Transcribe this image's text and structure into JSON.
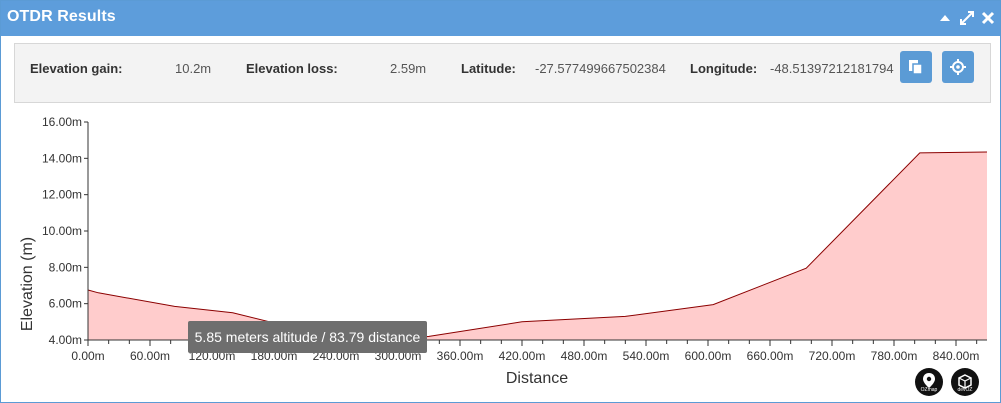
{
  "window": {
    "title": "OTDR Results"
  },
  "info": {
    "elevation_gain_label": "Elevation gain:",
    "elevation_gain_value": "10.2m",
    "elevation_loss_label": "Elevation loss:",
    "elevation_loss_value": "2.59m",
    "latitude_label": "Latitude:",
    "latitude_value": "-27.577499667502384",
    "longitude_label": "Longitude:",
    "longitude_value": "-48.51397212181794"
  },
  "tooltip": {
    "text": "5.85 meters altitude / 83.79 distance"
  },
  "logos": {
    "left": "OZmap",
    "right": "devOZ"
  },
  "colors": {
    "titlebar": "#5d9ddb",
    "fill": "#ffcccc",
    "line": "#8b0000",
    "button": "#5b9bd5"
  },
  "chart_data": {
    "type": "area",
    "xlabel": "Distance",
    "ylabel": "Elevation (m)",
    "xlim": [
      0,
      870
    ],
    "ylim": [
      4,
      16
    ],
    "x_ticks": [
      "0.00m",
      "60.00m",
      "120.00m",
      "180.00m",
      "240.00m",
      "300.00m",
      "360.00m",
      "420.00m",
      "480.00m",
      "540.00m",
      "600.00m",
      "660.00m",
      "720.00m",
      "780.00m",
      "840.00m"
    ],
    "y_ticks": [
      "4.00m",
      "6.00m",
      "8.00m",
      "10.00m",
      "12.00m",
      "14.00m",
      "16.00m"
    ],
    "x": [
      0,
      10,
      83.79,
      140,
      190,
      240,
      300,
      330,
      420,
      520,
      605,
      695,
      805,
      870
    ],
    "y": [
      6.75,
      6.6,
      5.85,
      5.5,
      4.8,
      4.3,
      3.95,
      4.2,
      5.0,
      5.3,
      5.95,
      7.95,
      14.3,
      14.35
    ],
    "grid": false
  }
}
